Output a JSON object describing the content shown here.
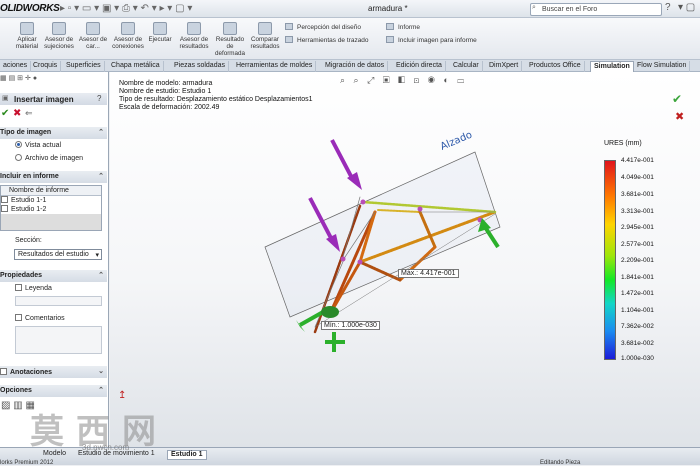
{
  "app": {
    "logo": "OLIDWORKS",
    "document_title": "armadura *",
    "search_placeholder": "Buscar en el Foro"
  },
  "ribbon": {
    "buttons": [
      "Aplicar material",
      "Asesor de sujeciones",
      "Asesor de car...",
      "Asesor de conexiones",
      "Ejecutar",
      "Asesor de resultados",
      "Resultado de deformada",
      "Comparar resultados"
    ],
    "rows": [
      "Percepción del diseño",
      "Herramientas de trazado",
      "Informe",
      "Incluir imagen para informe"
    ]
  },
  "tabs": [
    "aciones",
    "Croquis",
    "Superficies",
    "Chapa metálica",
    "Piezas soldadas",
    "Herramientas de moldes",
    "Migración de datos",
    "Edición directa",
    "Calcular",
    "DimXpert",
    "Productos Office",
    "Simulation",
    "Flow Simulation"
  ],
  "active_tab": "Simulation",
  "pm": {
    "title": "Insertar imagen",
    "image_type_header": "Tipo de imagen",
    "image_type_options": [
      "Vista actual",
      "Archivo de imagen"
    ],
    "include_header": "Incluir en informe",
    "table_header": "Nombre de informe",
    "reports": [
      "Estudio 1-1",
      "Estudio 1-2"
    ],
    "section_label": "Sección:",
    "section_value": "Resultados del estudio",
    "properties_header": "Propiedades",
    "legend_label": "Leyenda",
    "comments_label": "Comentarios",
    "annotations_header": "Anotaciones",
    "options_header": "Opciones"
  },
  "viewport": {
    "info_lines": [
      "Nombre de modelo: armadura",
      "Nombre de estudio: Estudio 1",
      "Tipo de resultado: Desplazamiento estático Desplazamientos1",
      "Escala de deformación: 2002.49"
    ],
    "plane_label": "Alzado",
    "max_label": "Máx.:",
    "max_value": "4.417e-001",
    "min_label": "Mín.:",
    "min_value": "1.000e-030"
  },
  "legend": {
    "title": "URES (mm)",
    "ticks": [
      "4.417e-001",
      "4.049e-001",
      "3.681e-001",
      "3.313e-001",
      "2.945e-001",
      "2.577e-001",
      "2.209e-001",
      "1.841e-001",
      "1.472e-001",
      "1.104e-001",
      "7.362e-002",
      "3.681e-002",
      "1.000e-030"
    ]
  },
  "bottom_tabs": [
    "Modelo",
    "Estudio de movimiento 1",
    "Estudio 1"
  ],
  "status": {
    "left": "lorks Premium 2012",
    "right": "Editando Pieza"
  },
  "watermark": {
    "text": "莫西网",
    "sub": "3d.nwcn.com"
  }
}
